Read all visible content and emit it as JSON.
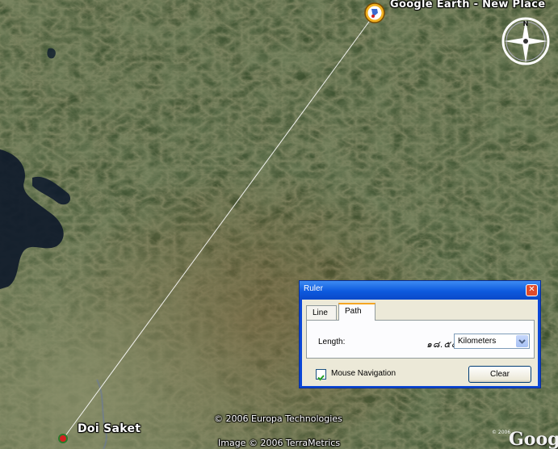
{
  "map": {
    "placemark_label": "Google Earth - New Place",
    "town_label": "Doi Saket",
    "credit_top": "© 2006 Europa Technologies",
    "credit_bottom": "Image © 2006 TerraMetrics",
    "small_credit": "© 2006",
    "logo": "Goog",
    "compass_label": "N",
    "icons": [
      "placemark-icon",
      "compass-icon",
      "town-marker-icon"
    ]
  },
  "ruler": {
    "title": "Ruler",
    "tabs": [
      {
        "label": "Line",
        "selected": false
      },
      {
        "label": "Path",
        "selected": true
      }
    ],
    "length_label": "Length:",
    "length_value": "๑๘.๕๔",
    "unit_selected": "Kilometers",
    "mouse_navigation_label": "Mouse Navigation",
    "mouse_navigation_checked": true,
    "clear_label": "Clear"
  },
  "colors": {
    "dialog_titlebar": "#0d5ade",
    "dialog_body": "#ece9d8",
    "close_button": "#e04b2a",
    "active_tab_accent": "#f5a623",
    "terrain_dark": "#2c3a1c",
    "terrain_light": "#5c6b3a",
    "water": "#0f1a2a"
  }
}
